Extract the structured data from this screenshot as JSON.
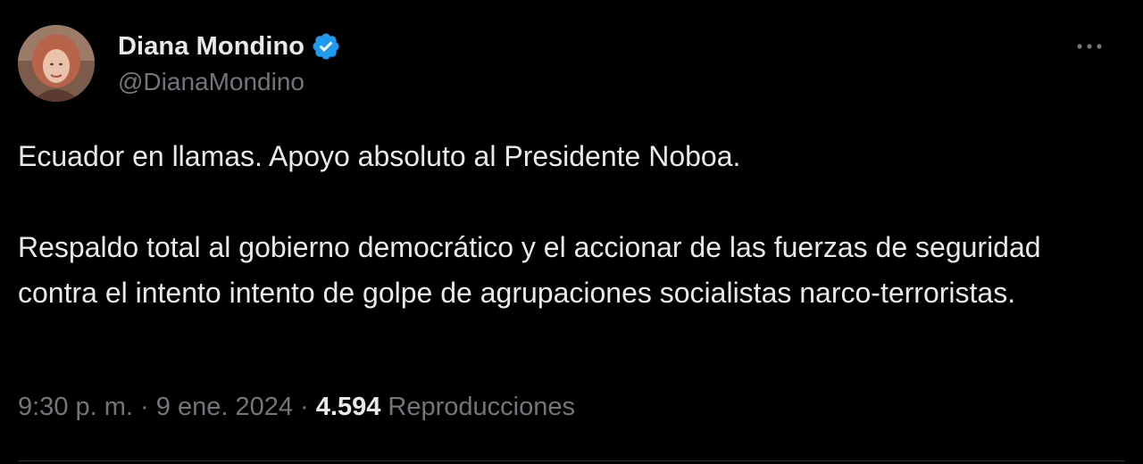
{
  "author": {
    "display_name": "Diana Mondino",
    "handle": "@DianaMondino",
    "verified_color": "#1d9bf0",
    "avatar_icon": "profile-photo",
    "verified_icon": "verified-badge-icon"
  },
  "menu": {
    "more_icon": "more-horizontal-icon"
  },
  "tweet": {
    "paragraphs": [
      "Ecuador en llamas. Apoyo absoluto al Presidente Noboa.",
      "Respaldo total al gobierno democrático y el accionar de las fuerzas de seguridad contra el intento intento de golpe de agrupaciones socialistas narco-terroristas."
    ]
  },
  "meta": {
    "time": "9:30 p. m.",
    "separator": "·",
    "date": "9 ene. 2024",
    "views_count": "4.594",
    "views_label": "Reproducciones"
  },
  "colors": {
    "background": "#000000",
    "text": "#e7e9ea",
    "secondary": "#71767b",
    "accent": "#1d9bf0"
  }
}
